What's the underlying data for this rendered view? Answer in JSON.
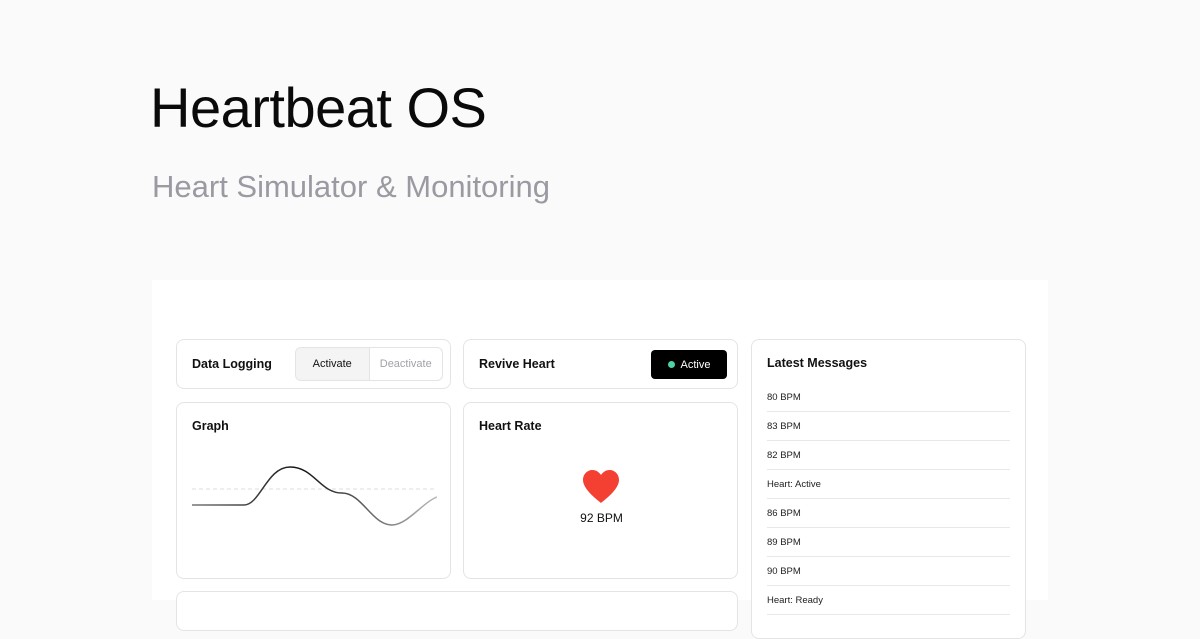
{
  "header": {
    "title": "Heartbeat OS",
    "subtitle": "Heart Simulator & Monitoring"
  },
  "logging": {
    "label": "Data Logging",
    "activate_label": "Activate",
    "deactivate_label": "Deactivate",
    "selected": "Activate"
  },
  "revive": {
    "label": "Revive Heart",
    "status_label": "Active",
    "status_color": "#4ed1a6"
  },
  "graph": {
    "label": "Graph"
  },
  "heart_rate": {
    "label": "Heart Rate",
    "value": "92 BPM",
    "heart_color": "#f43f33"
  },
  "messages": {
    "label": "Latest Messages",
    "items": [
      "80 BPM",
      "83 BPM",
      "82 BPM",
      "Heart: Active",
      "86 BPM",
      "89 BPM",
      "90 BPM",
      "Heart: Ready"
    ]
  }
}
